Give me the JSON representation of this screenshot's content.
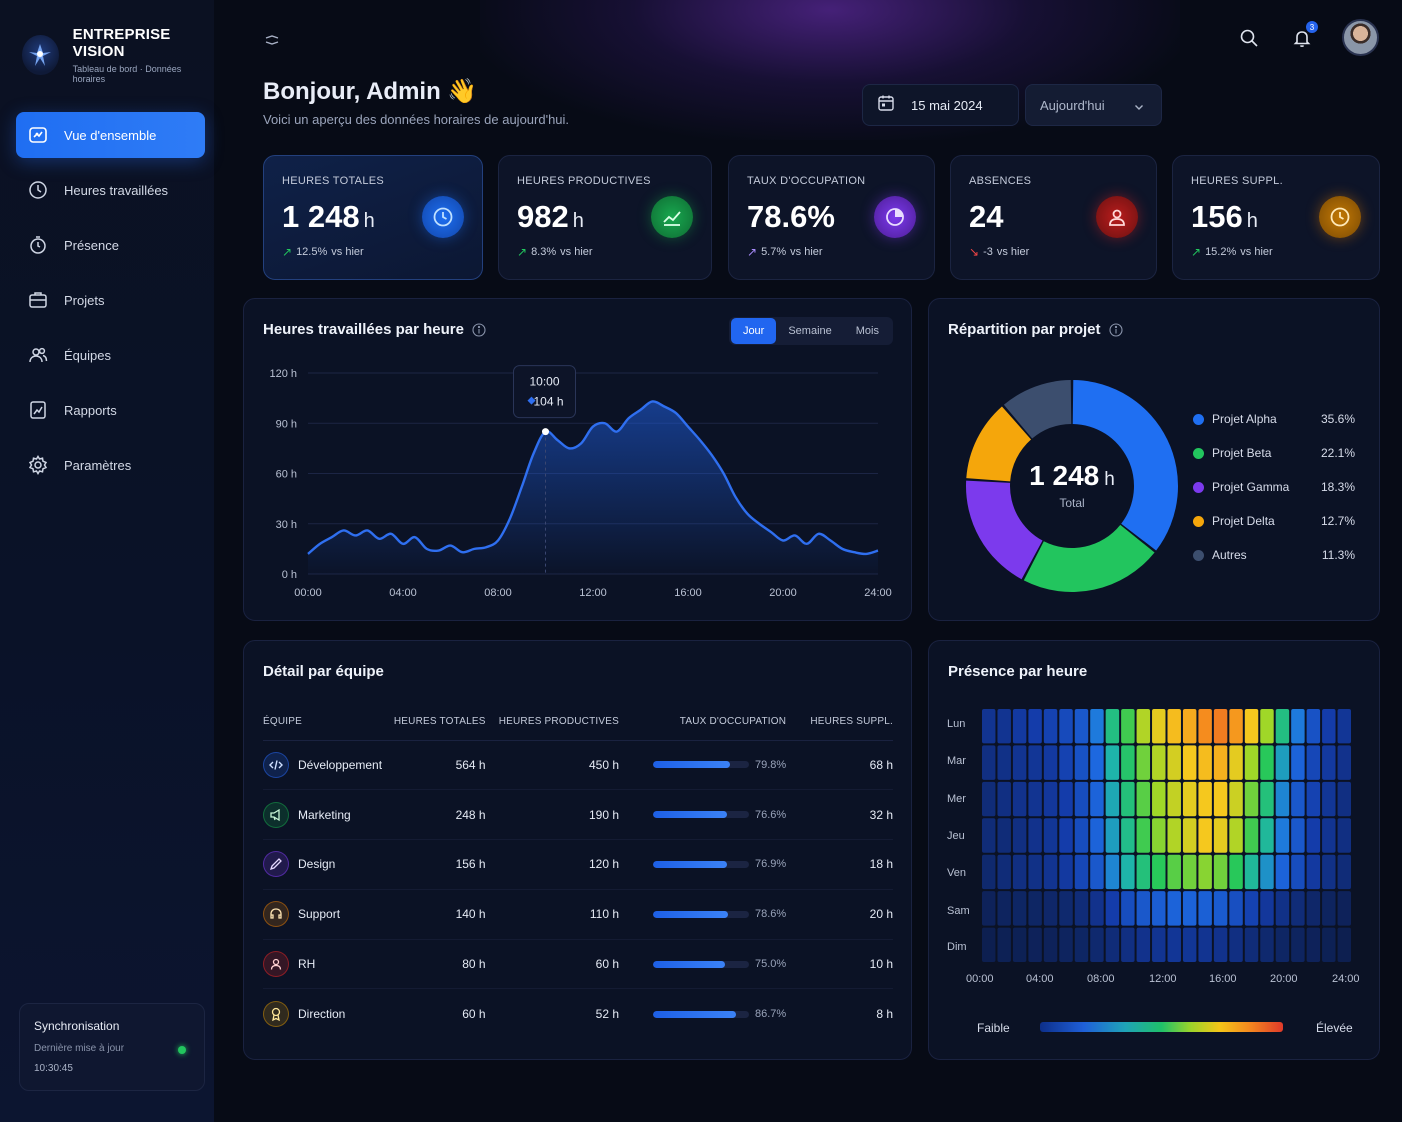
{
  "brand": {
    "title": "ENTREPRISE VISION",
    "subtitle": "Tableau de bord · Données horaires"
  },
  "nav": [
    {
      "label": "Vue d'ensemble",
      "icon": "dashboard-icon",
      "active": true
    },
    {
      "label": "Heures travaillées",
      "icon": "clock-icon",
      "active": false
    },
    {
      "label": "Présence",
      "icon": "stopwatch-icon",
      "active": false
    },
    {
      "label": "Projets",
      "icon": "briefcase-icon",
      "active": false
    },
    {
      "label": "Équipes",
      "icon": "users-icon",
      "active": false
    },
    {
      "label": "Rapports",
      "icon": "report-icon",
      "active": false
    },
    {
      "label": "Paramètres",
      "icon": "gear-icon",
      "active": false
    }
  ],
  "sync": {
    "title": "Synchronisation",
    "label": "Dernière mise à jour",
    "time": "10:30:45"
  },
  "topbar": {
    "notifications": "3"
  },
  "header": {
    "greeting": "Bonjour, Admin 👋",
    "subtitle": "Voici un aperçu des données horaires de aujourd'hui.",
    "date": "15 mai 2024",
    "period": "Aujourd'hui"
  },
  "kpis": [
    {
      "label": "HEURES TOTALES",
      "value": "1 248",
      "unit": "h",
      "trend": "12.5%",
      "dir": "up",
      "vs": "vs hier",
      "color": "#1d6ff2"
    },
    {
      "label": "HEURES PRODUCTIVES",
      "value": "982",
      "unit": "h",
      "trend": "8.3%",
      "dir": "up",
      "vs": "vs hier",
      "color": "#16a34a"
    },
    {
      "label": "TAUX D'OCCUPATION",
      "value": "78.6%",
      "unit": "",
      "trend": "5.7%",
      "dir": "up-purple",
      "vs": "vs hier",
      "color": "#7c3aed"
    },
    {
      "label": "ABSENCES",
      "value": "24",
      "unit": "",
      "trend": "-3",
      "dir": "down",
      "vs": "vs hier",
      "color": "#dc2626"
    },
    {
      "label": "HEURES SUPPL.",
      "value": "156",
      "unit": "h",
      "trend": "15.2%",
      "dir": "up",
      "vs": "vs hier",
      "color": "#d97706"
    }
  ],
  "line_panel": {
    "title": "Heures travaillées par heure",
    "tabs": [
      "Jour",
      "Semaine",
      "Mois"
    ],
    "active_tab": "Jour",
    "tooltip_time": "10:00",
    "tooltip_value": "104 h"
  },
  "donut_panel": {
    "title": "Répartition par projet",
    "center_value": "1 248",
    "center_unit": "h",
    "center_label": "Total"
  },
  "table_panel": {
    "title": "Détail par équipe",
    "columns": [
      "ÉQUIPE",
      "HEURES TOTALES",
      "HEURES PRODUCTIVES",
      "TAUX D'OCCUPATION",
      "HEURES SUPPL."
    ],
    "rows": [
      {
        "team": "Développement",
        "icon": "code-icon",
        "color": "#2563eb",
        "total": "564 h",
        "productive": "450 h",
        "occupation": "79.8%",
        "occ_value": 79.8,
        "extra": "68 h"
      },
      {
        "team": "Marketing",
        "icon": "megaphone-icon",
        "color": "#16a34a",
        "total": "248 h",
        "productive": "190 h",
        "occupation": "76.6%",
        "occ_value": 76.6,
        "extra": "32 h"
      },
      {
        "team": "Design",
        "icon": "pen-icon",
        "color": "#7c3aed",
        "total": "156 h",
        "productive": "120 h",
        "occupation": "76.9%",
        "occ_value": 76.9,
        "extra": "18 h"
      },
      {
        "team": "Support",
        "icon": "headset-icon",
        "color": "#d97706",
        "total": "140 h",
        "productive": "110 h",
        "occupation": "78.6%",
        "occ_value": 78.6,
        "extra": "20 h"
      },
      {
        "team": "RH",
        "icon": "person-icon",
        "color": "#dc2626",
        "total": "80 h",
        "productive": "60 h",
        "occupation": "75.0%",
        "occ_value": 75.0,
        "extra": "10 h"
      },
      {
        "team": "Direction",
        "icon": "award-icon",
        "color": "#ca8a04",
        "total": "60 h",
        "productive": "52 h",
        "occupation": "86.7%",
        "occ_value": 86.7,
        "extra": "8 h"
      }
    ]
  },
  "heatmap_panel": {
    "title": "Présence par heure",
    "days": [
      "Lun",
      "Mar",
      "Mer",
      "Jeu",
      "Ven",
      "Sam",
      "Dim"
    ],
    "x_ticks": [
      "00:00",
      "04:00",
      "08:00",
      "12:00",
      "16:00",
      "20:00",
      "24:00"
    ],
    "scale_low": "Faible",
    "scale_high": "Élevée"
  },
  "chart_data": [
    {
      "type": "area",
      "title": "Heures travaillées par heure",
      "x_ticks": [
        "00:00",
        "04:00",
        "08:00",
        "12:00",
        "16:00",
        "20:00",
        "24:00"
      ],
      "y_ticks": [
        "0 h",
        "30 h",
        "60 h",
        "90 h",
        "120 h"
      ],
      "ylim": [
        0,
        120
      ],
      "xlim": [
        0,
        24
      ],
      "grid": true,
      "color": "#2f6ff0",
      "x": [
        0,
        0.5,
        1,
        1.5,
        2,
        2.5,
        3,
        3.5,
        4,
        4.5,
        5,
        5.5,
        6,
        6.5,
        7,
        7.5,
        8,
        8.5,
        9,
        9.5,
        10,
        10.5,
        11,
        11.5,
        12,
        12.5,
        13,
        13.5,
        14,
        14.5,
        15,
        15.5,
        16,
        16.5,
        17,
        17.5,
        18,
        18.5,
        19,
        19.5,
        20,
        20.5,
        21,
        21.5,
        22,
        22.5,
        23,
        23.5,
        24
      ],
      "y": [
        12,
        18,
        22,
        26,
        23,
        26,
        21,
        24,
        18,
        22,
        15,
        14,
        17,
        13,
        15,
        16,
        20,
        33,
        52,
        72,
        85,
        80,
        75,
        78,
        88,
        90,
        85,
        93,
        98,
        103,
        100,
        96,
        88,
        80,
        71,
        60,
        46,
        36,
        30,
        25,
        20,
        23,
        18,
        24,
        20,
        15,
        13,
        12,
        14
      ]
    },
    {
      "type": "pie",
      "title": "Répartition par projet",
      "labels": [
        "Projet Alpha",
        "Projet Beta",
        "Projet Gamma",
        "Projet Delta",
        "Autres"
      ],
      "values": [
        35.6,
        22.1,
        18.3,
        12.7,
        11.3
      ],
      "display": [
        "35.6%",
        "22.1%",
        "18.3%",
        "12.7%",
        "11.3%"
      ],
      "colors": [
        "#1f6ff2",
        "#22c55e",
        "#7c3aed",
        "#f5a60b",
        "#3c4e6e"
      ],
      "legend": "right"
    },
    {
      "type": "heatmap",
      "title": "Présence par heure",
      "rows": [
        "Lun",
        "Mar",
        "Mer",
        "Jeu",
        "Ven",
        "Sam",
        "Dim"
      ],
      "columns_hours": 24,
      "values": [
        [
          0.15,
          0.15,
          0.18,
          0.2,
          0.22,
          0.25,
          0.3,
          0.4,
          0.55,
          0.62,
          0.72,
          0.78,
          0.82,
          0.85,
          0.9,
          0.92,
          0.88,
          0.8,
          0.7,
          0.55,
          0.4,
          0.28,
          0.2,
          0.16
        ],
        [
          0.12,
          0.13,
          0.15,
          0.16,
          0.18,
          0.22,
          0.28,
          0.36,
          0.5,
          0.58,
          0.66,
          0.72,
          0.76,
          0.8,
          0.82,
          0.84,
          0.78,
          0.7,
          0.6,
          0.46,
          0.34,
          0.24,
          0.18,
          0.14
        ],
        [
          0.1,
          0.12,
          0.14,
          0.15,
          0.17,
          0.2,
          0.26,
          0.34,
          0.48,
          0.56,
          0.64,
          0.7,
          0.74,
          0.78,
          0.8,
          0.8,
          0.75,
          0.66,
          0.56,
          0.42,
          0.3,
          0.22,
          0.16,
          0.12
        ],
        [
          0.1,
          0.1,
          0.12,
          0.14,
          0.16,
          0.2,
          0.26,
          0.34,
          0.46,
          0.54,
          0.62,
          0.68,
          0.72,
          0.76,
          0.8,
          0.78,
          0.72,
          0.62,
          0.52,
          0.4,
          0.3,
          0.2,
          0.15,
          0.12
        ],
        [
          0.08,
          0.1,
          0.12,
          0.13,
          0.15,
          0.18,
          0.24,
          0.3,
          0.42,
          0.5,
          0.56,
          0.6,
          0.64,
          0.66,
          0.68,
          0.66,
          0.6,
          0.52,
          0.44,
          0.34,
          0.26,
          0.18,
          0.13,
          0.1
        ],
        [
          0.04,
          0.05,
          0.06,
          0.06,
          0.07,
          0.08,
          0.1,
          0.14,
          0.2,
          0.26,
          0.3,
          0.32,
          0.34,
          0.34,
          0.33,
          0.31,
          0.27,
          0.22,
          0.17,
          0.13,
          0.1,
          0.07,
          0.05,
          0.04
        ],
        [
          0.02,
          0.03,
          0.03,
          0.04,
          0.04,
          0.05,
          0.06,
          0.08,
          0.1,
          0.12,
          0.14,
          0.15,
          0.16,
          0.16,
          0.15,
          0.14,
          0.12,
          0.1,
          0.08,
          0.06,
          0.05,
          0.04,
          0.03,
          0.02
        ]
      ]
    }
  ]
}
